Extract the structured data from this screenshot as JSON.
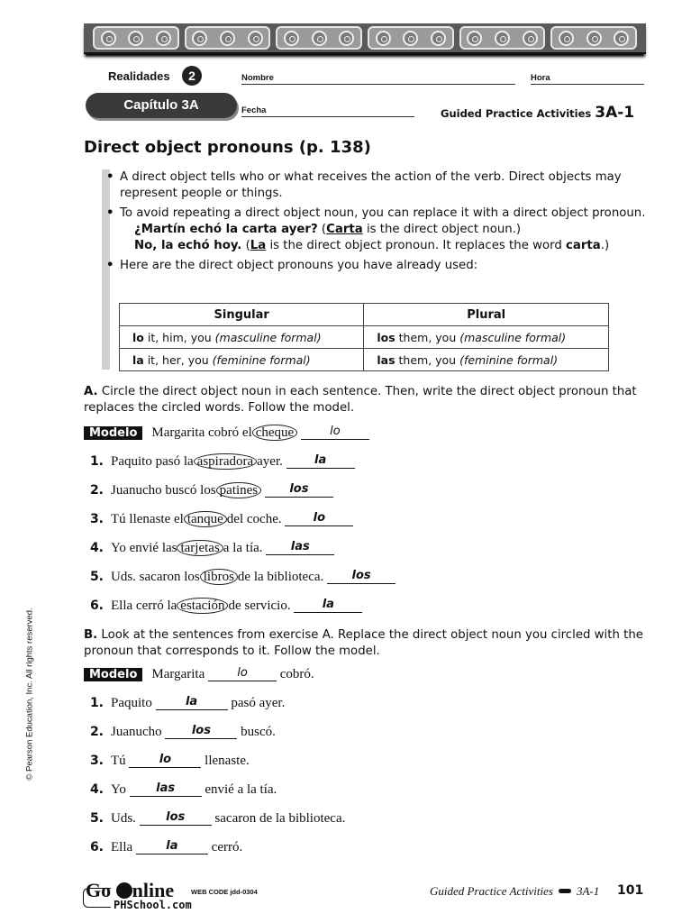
{
  "header": {
    "series": "Realidades",
    "level": "2",
    "chapter": "Capítulo 3A",
    "name_label": "Nombre",
    "hour_label": "Hora",
    "date_label": "Fecha",
    "activity_label": "Guided Practice Activities",
    "activity_code": "3A-1"
  },
  "section": {
    "title": "Direct object pronouns (p. 138)",
    "bullets": [
      "A direct object tells who or what receives the action of the verb. Direct objects may represent people or things.",
      "To avoid repeating a direct object noun, you can replace it with a direct object pronoun.",
      "Here are the direct object pronouns you have already used:"
    ],
    "example1": {
      "question": "¿Martín echó la carta ayer?",
      "paren_open": " (",
      "underlined": "Carta",
      "rest": " is the direct object noun.)"
    },
    "example2": {
      "answer": "No, la echó hoy.",
      "paren_open": " (",
      "underlined": "La",
      "rest": " is the direct object pronoun. It replaces the word ",
      "bold_word": "carta",
      "close": ".)"
    }
  },
  "table": {
    "headers": [
      "Singular",
      "Plural"
    ],
    "rows": [
      [
        {
          "pronoun": "lo",
          "meaning": " it, him, you ",
          "note": "(masculine formal)"
        },
        {
          "pronoun": "los",
          "meaning": " them, you ",
          "note": "(masculine formal)"
        }
      ],
      [
        {
          "pronoun": "la",
          "meaning": " it, her, you ",
          "note": "(feminine formal)"
        },
        {
          "pronoun": "las",
          "meaning": " them, you ",
          "note": "(feminine formal)"
        }
      ]
    ]
  },
  "exercise_a": {
    "letter": "A.",
    "instructions": " Circle the direct object noun in each sentence. Then, write the direct object pronoun that replaces the circled words. Follow the model.",
    "model_label": "Modelo",
    "model": {
      "before": "Margarita cobró el",
      "circled": "cheque",
      "after": "",
      "answer": "lo"
    },
    "items": [
      {
        "num": "1.",
        "before": "Paquito pasó la",
        "circled": "aspiradora",
        "after": "ayer.",
        "answer": "la"
      },
      {
        "num": "2.",
        "before": "Juanucho buscó los",
        "circled": "patines",
        "after": "",
        "answer": "los"
      },
      {
        "num": "3.",
        "before": "Tú llenaste el",
        "circled": "tanque",
        "after": "del coche.",
        "answer": "lo"
      },
      {
        "num": "4.",
        "before": "Yo envié las",
        "circled": "tarjetas",
        "after": "a la tía.",
        "answer": "las"
      },
      {
        "num": "5.",
        "before": "Uds. sacaron los",
        "circled": "libros",
        "after": "de la biblioteca.",
        "answer": "los"
      },
      {
        "num": "6.",
        "before": "Ella cerró la",
        "circled": "estación",
        "after": "de servicio.",
        "answer": "la"
      }
    ]
  },
  "exercise_b": {
    "letter": "B.",
    "instructions": " Look at the sentences from exercise A. Replace the direct object noun you circled with the pronoun that corresponds to it. Follow the model.",
    "model_label": "Modelo",
    "model": {
      "before": "Margarita",
      "answer": "lo",
      "after": "cobró."
    },
    "items": [
      {
        "num": "1.",
        "before": "Paquito",
        "answer": "la",
        "after": "pasó ayer."
      },
      {
        "num": "2.",
        "before": "Juanucho",
        "answer": "los",
        "after": "buscó."
      },
      {
        "num": "3.",
        "before": "Tú",
        "answer": "lo",
        "after": "llenaste."
      },
      {
        "num": "4.",
        "before": "Yo",
        "answer": "las",
        "after": "envié a la tía."
      },
      {
        "num": "5.",
        "before": "Uds.",
        "answer": "los",
        "after": "sacaron de la biblioteca."
      },
      {
        "num": "6.",
        "before": "Ella",
        "answer": "la",
        "after": "cerró."
      }
    ]
  },
  "footer": {
    "go": "Go",
    "online": "nline",
    "web_code": "WEB CODE jdd-0304",
    "site": "PHSchool.com",
    "book": "Guided Practice Activities",
    "code": "3A-1",
    "page": "101",
    "copyright": "© Pearson Education, Inc. All rights reserved."
  }
}
